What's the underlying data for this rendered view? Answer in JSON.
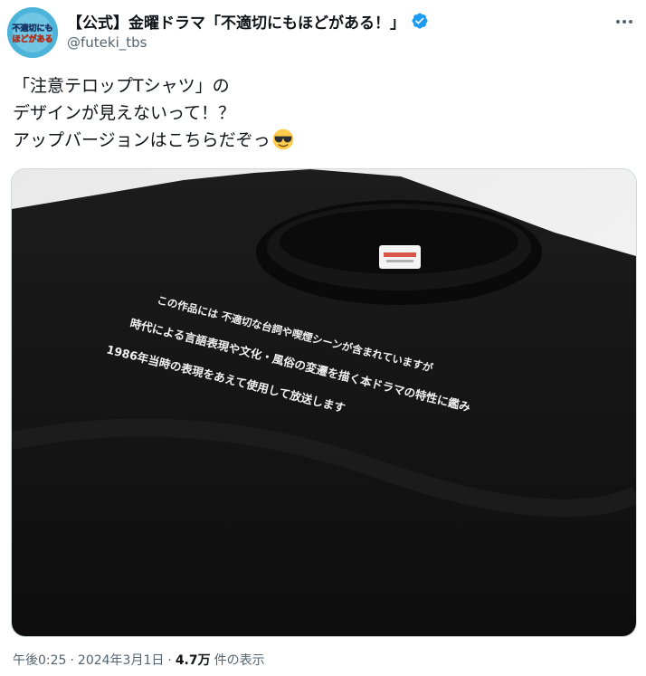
{
  "account": {
    "display_name": "【公式】金曜ドラマ「不適切にもほどがある！」",
    "handle": "@futeki_tbs",
    "verified": true,
    "avatar_text_top": "不適切にも",
    "avatar_text_bottom": "ほどがある",
    "verified_color": "#1d9bf0"
  },
  "tweet": {
    "lines": [
      "「注意テロップTシャツ」の",
      "デザインが見えないって！？",
      "アップバージョンはこちらだぞっ"
    ],
    "emoji": "sunglasses-emoji"
  },
  "media": {
    "shirt_lines": [
      "この作品には 不適切な台詞や喫煙シーンが含まれていますが",
      "時代による言語表現や文化・風俗の変遷を描く本ドラマの特性に鑑み",
      "1986年当時の表現をあえて使用して放送します"
    ]
  },
  "footer": {
    "time": "午後0:25",
    "separator": "·",
    "date": "2024年3月1日",
    "views_count": "4.7万",
    "views_label": "件の表示"
  }
}
